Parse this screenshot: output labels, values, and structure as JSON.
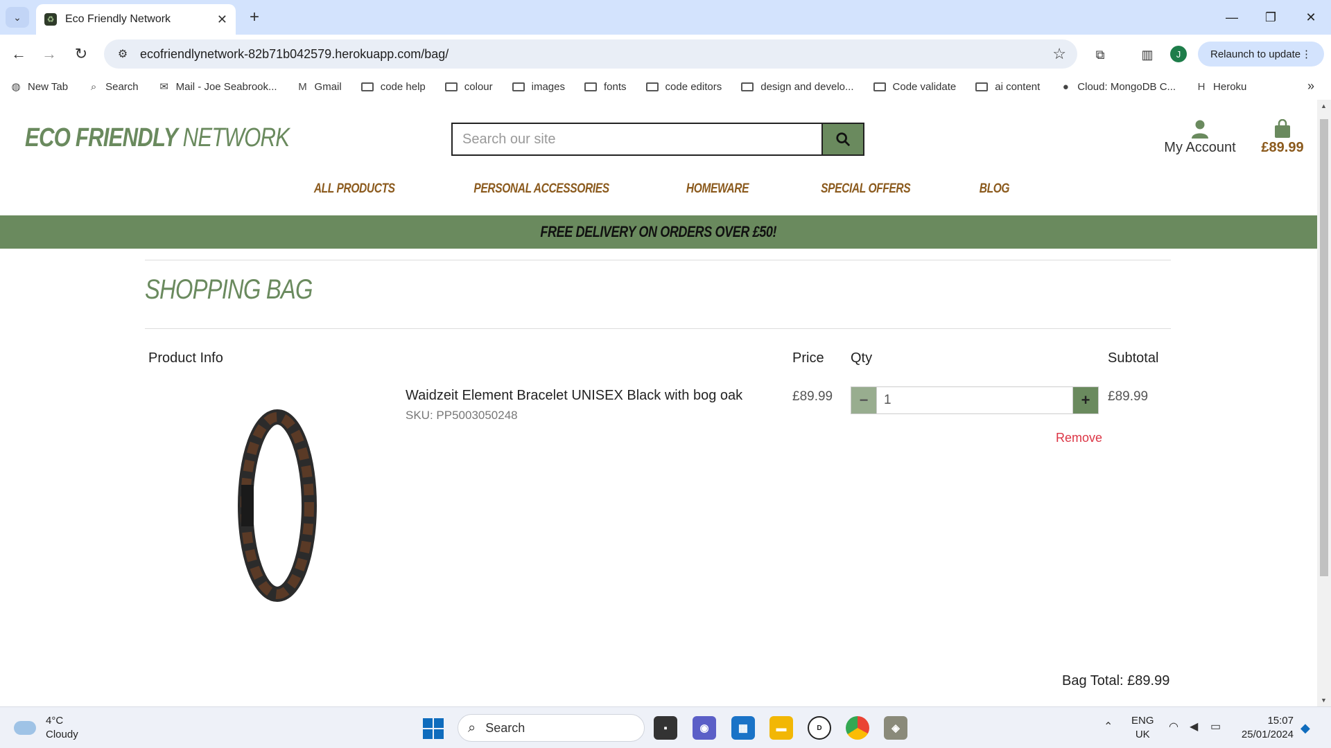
{
  "browser": {
    "tab_title": "Eco Friendly Network",
    "tab_favicon": "♻",
    "url": "ecofriendlynetwork-82b71b042579.herokuapp.com/bag/",
    "profile_initial": "J",
    "relaunch_label": "Relaunch to update",
    "bookmarks": [
      {
        "label": "New Tab",
        "icon": "globe-icon",
        "type": "link"
      },
      {
        "label": "Search",
        "icon": "search-icon",
        "type": "link"
      },
      {
        "label": "Mail - Joe Seabrook...",
        "icon": "outlook-icon",
        "type": "link"
      },
      {
        "label": "Gmail",
        "icon": "gmail-icon",
        "type": "link"
      },
      {
        "label": "code help",
        "icon": "folder-icon",
        "type": "folder"
      },
      {
        "label": "colour",
        "icon": "folder-icon",
        "type": "folder"
      },
      {
        "label": "images",
        "icon": "folder-icon",
        "type": "folder"
      },
      {
        "label": "fonts",
        "icon": "folder-icon",
        "type": "folder"
      },
      {
        "label": "code editors",
        "icon": "folder-icon",
        "type": "folder"
      },
      {
        "label": "design and develo...",
        "icon": "folder-icon",
        "type": "folder"
      },
      {
        "label": "Code validate",
        "icon": "folder-icon",
        "type": "folder"
      },
      {
        "label": "ai content",
        "icon": "folder-icon",
        "type": "folder"
      },
      {
        "label": "Cloud: MongoDB C...",
        "icon": "mongodb-icon",
        "type": "link"
      },
      {
        "label": "Heroku",
        "icon": "heroku-icon",
        "type": "link"
      }
    ]
  },
  "site": {
    "logo_part1": "ECO FRIENDLY",
    "logo_part2": " NETWORK",
    "search_placeholder": "Search our site",
    "account_label": "My Account",
    "bag_amount": "£89.99",
    "nav": [
      "ALL PRODUCTS",
      "PERSONAL ACCESSORIES",
      "HOMEWARE",
      "SPECIAL OFFERS",
      "BLOG"
    ],
    "banner": "FREE DELIVERY ON ORDERS OVER £50!",
    "brand_color": "#6a8a5e",
    "accent_color": "#8b5a1d"
  },
  "bag": {
    "title": "SHOPPING BAG",
    "headers": {
      "product": "Product Info",
      "price": "Price",
      "qty": "Qty",
      "subtotal": "Subtotal"
    },
    "item": {
      "name": "Waidzeit Element Bracelet UNISEX Black with bog oak",
      "sku": "SKU: PP5003050248",
      "price": "£89.99",
      "qty": "1",
      "subtotal": "£89.99",
      "remove_label": "Remove"
    },
    "total": "Bag Total: £89.99"
  },
  "taskbar": {
    "temperature": "4°C",
    "weather": "Cloudy",
    "search_label": "Search",
    "lang_line1": "ENG",
    "lang_line2": "UK",
    "time": "15:07",
    "date": "25/01/2024"
  }
}
